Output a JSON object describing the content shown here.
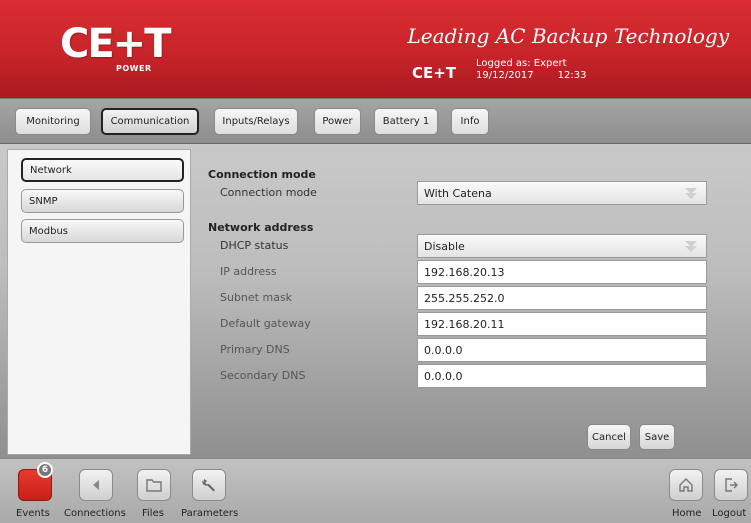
{
  "header": {
    "logo_text": "CE+T",
    "logo_sub": "POWER",
    "tagline": "Leading AC Backup Technology",
    "brand": "CE+T",
    "logged_as": "Logged as: Expert",
    "date": "19/12/2017",
    "time": "12:33"
  },
  "tabs": [
    {
      "label": "Monitoring"
    },
    {
      "label": "Communication"
    },
    {
      "label": "Inputs/Relays"
    },
    {
      "label": "Power"
    },
    {
      "label": "Battery 1"
    },
    {
      "label": "Info"
    }
  ],
  "sidebar": {
    "items": [
      {
        "label": "Network"
      },
      {
        "label": "SNMP"
      },
      {
        "label": "Modbus"
      }
    ]
  },
  "form": {
    "connection_mode_title": "Connection mode",
    "connection_mode_label": "Connection mode",
    "connection_mode_value": "With Catena",
    "network_address_title": "Network address",
    "dhcp_label": "DHCP status",
    "dhcp_value": "Disable",
    "ip_label": "IP address",
    "ip_value": "192.168.20.13",
    "subnet_label": "Subnet mask",
    "subnet_value": "255.255.252.0",
    "gateway_label": "Default gateway",
    "gateway_value": "192.168.20.11",
    "dns1_label": "Primary DNS",
    "dns1_value": "0.0.0.0",
    "dns2_label": "Secondary DNS",
    "dns2_value": "0.0.0.0",
    "cancel_label": "Cancel",
    "save_label": "Save"
  },
  "footer": {
    "events_label": "Events",
    "events_count": "6",
    "connections_label": "Connections",
    "files_label": "Files",
    "parameters_label": "Parameters",
    "home_label": "Home",
    "logout_label": "Logout"
  },
  "colors": {
    "header_red": "#c8242a",
    "events_red": "#e02b22"
  }
}
